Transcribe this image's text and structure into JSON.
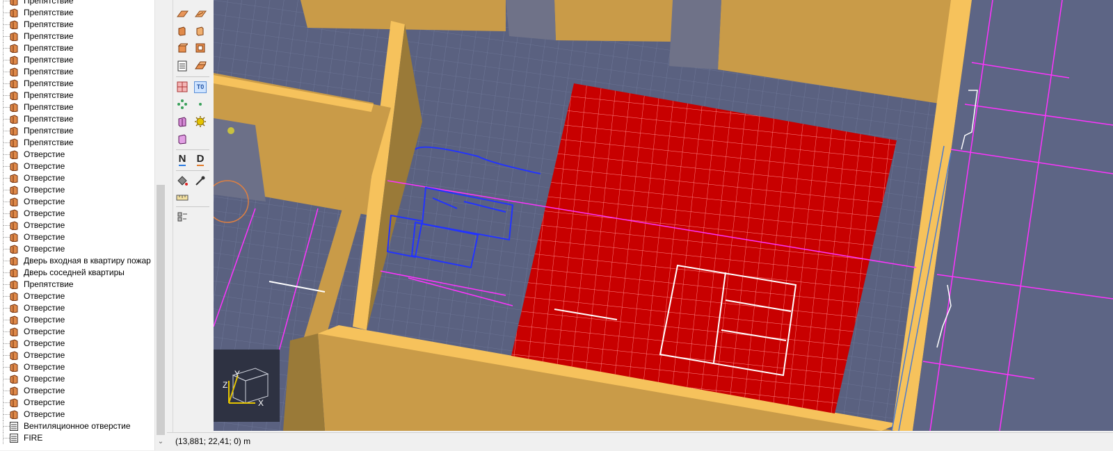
{
  "tree": {
    "items": [
      {
        "label": "Препятствие",
        "icon": "box-icon"
      },
      {
        "label": "Препятствие",
        "icon": "box-icon"
      },
      {
        "label": "Препятствие",
        "icon": "box-icon"
      },
      {
        "label": "Препятствие",
        "icon": "box-icon"
      },
      {
        "label": "Препятствие",
        "icon": "box-icon"
      },
      {
        "label": "Препятствие",
        "icon": "box-icon"
      },
      {
        "label": "Препятствие",
        "icon": "box-icon"
      },
      {
        "label": "Препятствие",
        "icon": "box-icon"
      },
      {
        "label": "Препятствие",
        "icon": "box-icon"
      },
      {
        "label": "Препятствие",
        "icon": "box-icon"
      },
      {
        "label": "Препятствие",
        "icon": "box-icon"
      },
      {
        "label": "Препятствие",
        "icon": "box-icon"
      },
      {
        "label": "Препятствие",
        "icon": "box-icon"
      },
      {
        "label": "Отверстие",
        "icon": "box-icon"
      },
      {
        "label": "Отверстие",
        "icon": "box-icon"
      },
      {
        "label": "Отверстие",
        "icon": "box-icon"
      },
      {
        "label": "Отверстие",
        "icon": "box-icon"
      },
      {
        "label": "Отверстие",
        "icon": "box-icon"
      },
      {
        "label": "Отверстие",
        "icon": "box-icon"
      },
      {
        "label": "Отверстие",
        "icon": "box-icon"
      },
      {
        "label": "Отверстие",
        "icon": "box-icon"
      },
      {
        "label": "Отверстие",
        "icon": "box-icon"
      },
      {
        "label": "Дверь входная в квартиру пожар",
        "icon": "box-icon"
      },
      {
        "label": "Дверь соседней квартиры",
        "icon": "box-icon"
      },
      {
        "label": "Препятствие",
        "icon": "box-icon"
      },
      {
        "label": "Отверстие",
        "icon": "box-icon"
      },
      {
        "label": "Отверстие",
        "icon": "box-icon"
      },
      {
        "label": "Отверстие",
        "icon": "box-icon"
      },
      {
        "label": "Отверстие",
        "icon": "box-icon"
      },
      {
        "label": "Отверстие",
        "icon": "box-icon"
      },
      {
        "label": "Отверстие",
        "icon": "box-icon"
      },
      {
        "label": "Отверстие",
        "icon": "box-icon"
      },
      {
        "label": "Отверстие",
        "icon": "box-icon"
      },
      {
        "label": "Отверстие",
        "icon": "box-icon"
      },
      {
        "label": "Отверстие",
        "icon": "box-icon"
      },
      {
        "label": "Отверстие",
        "icon": "box-icon"
      },
      {
        "label": "Вентиляционное отверстие",
        "icon": "list-icon"
      },
      {
        "label": "FIRE",
        "icon": "list-icon"
      }
    ]
  },
  "toolbar": {
    "buttons": [
      {
        "name": "slab-tool-icon"
      },
      {
        "name": "slab-tool-2-icon"
      },
      {
        "name": "obstruction-tool-icon"
      },
      {
        "name": "obstruction-tool-2-icon"
      },
      {
        "name": "block-tool-icon"
      },
      {
        "name": "hole-tool-icon"
      },
      {
        "name": "list-tool-icon"
      },
      {
        "name": "stair-tool-icon"
      },
      {
        "name": "split-tool-icon"
      },
      {
        "name": "text-tool-icon"
      },
      {
        "name": "device-tool-icon"
      },
      {
        "name": "point-tool-icon"
      },
      {
        "name": "vent-tool-icon"
      },
      {
        "name": "fire-tool-icon"
      },
      {
        "name": "wall-tool-icon"
      },
      {
        "name": "north-tool-icon"
      },
      {
        "name": "dimension-tool-icon"
      },
      {
        "name": "paint-bucket-icon"
      },
      {
        "name": "eyedropper-icon"
      },
      {
        "name": "measure-ruler-icon"
      },
      {
        "name": "align-tool-icon"
      }
    ],
    "texts": {
      "t0": "T0",
      "n": "N",
      "d": "D"
    }
  },
  "viewport": {
    "axes": {
      "x": "X",
      "y": "Y",
      "z": "Z"
    },
    "colors": {
      "floor": "#5a6180",
      "wall": "#f6c25c",
      "fire": "#c80000",
      "dim": "#ff33ff",
      "blue": "#2233ff"
    }
  },
  "status": {
    "coords": "(13,881; 22,41; 0) m"
  },
  "scrollbar": {
    "down_arrow": "⌄"
  }
}
